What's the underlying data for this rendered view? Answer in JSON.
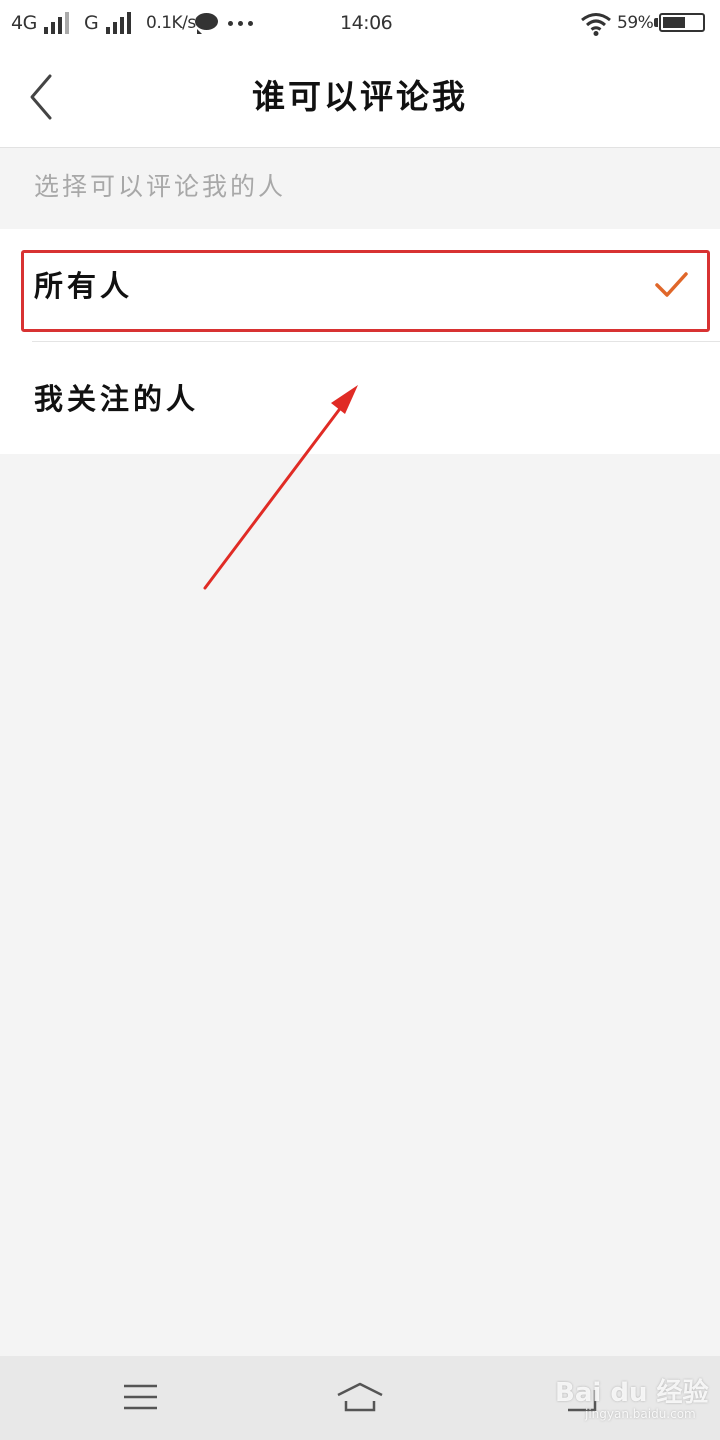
{
  "status_bar": {
    "network_1": "4G",
    "network_2": "G",
    "speed": "0.1K/s",
    "time": "14:06",
    "battery": "59%",
    "battery_level": 0.59
  },
  "header": {
    "title": "谁可以评论我",
    "back_icon": "chevron-left-icon"
  },
  "section": {
    "caption": "选择可以评论我的人"
  },
  "options": [
    {
      "label": "所有人",
      "selected": true
    },
    {
      "label": "我关注的人",
      "selected": false
    }
  ],
  "check_color": "#e0672a",
  "annotation_color": "#e02b25",
  "nav_bar": {
    "icons": [
      "menu-icon",
      "home-icon",
      "back-icon"
    ]
  },
  "watermark": {
    "text": "Bai du 经验",
    "sub": "jingyan.baidu.com"
  }
}
